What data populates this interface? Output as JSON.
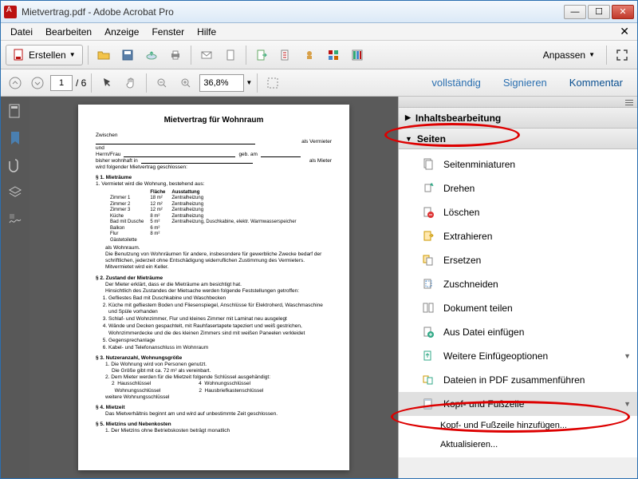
{
  "window": {
    "title": "Mietvertrag.pdf - Adobe Acrobat Pro"
  },
  "menu": {
    "file": "Datei",
    "edit": "Bearbeiten",
    "view": "Anzeige",
    "window": "Fenster",
    "help": "Hilfe"
  },
  "toolbar": {
    "create": "Erstellen",
    "customize": "Anpassen"
  },
  "pagebar": {
    "page": "1",
    "of": "/ 6",
    "zoom": "36,8%",
    "full": "vollständig",
    "sign": "Signieren",
    "comment": "Kommentar"
  },
  "rightpanel": {
    "content_edit": "Inhaltsbearbeitung",
    "pages": "Seiten",
    "items": {
      "thumbnails": "Seitenminiaturen",
      "rotate": "Drehen",
      "delete": "Löschen",
      "extract": "Extrahieren",
      "replace": "Ersetzen",
      "crop": "Zuschneiden",
      "split": "Dokument teilen",
      "insert_file": "Aus Datei einfügen",
      "more_insert": "Weitere Einfügeoptionen",
      "combine": "Dateien in PDF zusammenführen",
      "header_footer": "Kopf- und Fußzeile",
      "hf_add": "Kopf- und Fußzeile hinzufügen...",
      "hf_update": "Aktualisieren..."
    }
  },
  "doc": {
    "title": "Mietvertrag für Wohnraum",
    "between": "Zwischen",
    "as_landlord": "als Vermieter",
    "and": "und",
    "mrms": "Herrn/Frau",
    "born": "geb. am",
    "resident": "bisher wohnhaft in",
    "as_tenant": "als Mieter",
    "concluded": "wird folgender Mietvertrag geschlossen:",
    "s1": "§ 1.  Mieträume",
    "s1_1": "1.  Vermietet wird die Wohnung, bestehend aus:",
    "table_head": {
      "area": "Fläche",
      "equip": "Ausstattung"
    },
    "rooms": [
      {
        "n": "Zimmer 1",
        "a": "18 m²",
        "e": "Zentralheizung"
      },
      {
        "n": "Zimmer 2",
        "a": "12 m²",
        "e": "Zentralheizung"
      },
      {
        "n": "Zimmer 3",
        "a": "12 m²",
        "e": "Zentralheizung"
      },
      {
        "n": "Küche",
        "a": "8 m²",
        "e": "Zentralheizung"
      },
      {
        "n": "Bad mit Dusche",
        "a": "5 m²",
        "e": "Zentralheizung, Duschkabine, elektr. Warmwasserspeicher"
      },
      {
        "n": "Balkon",
        "a": "6 m²",
        "e": ""
      },
      {
        "n": "Flur",
        "a": "8 m²",
        "e": ""
      },
      {
        "n": "Gästetoilette",
        "a": "",
        "e": ""
      }
    ],
    "no_common": "als Wohnraum.",
    "s1_note": "Die Benutzung von Wohnräumen für andere, insbesondere für gewerbliche Zwecke bedarf der schriftlichen, jederzeit ohne Entschädigung widerruflichen Zustimmung des Vermieters. Mitvermietet wird ein Keller.",
    "s2": "§ 2.  Zustand der Mieträume",
    "s2_intro1": "Der Mieter erklärt, dass er die Mieträume am                      besichtigt hat.",
    "s2_intro2": "Hinsichtlich des Zustandes der Mietsache werden folgende Feststellungen getroffen:",
    "s2_items": [
      "Gefliestes Bad mit Duschkabine und Waschbecken",
      "Küche mit gefliestem Boden und Fliesenspiegel, Anschlüsse für Elektroherd, Waschmaschine und Spüle vorhanden",
      "Schlaf- und Wohnzimmer, Flur und kleines Zimmer mit Laminat neu ausgelegt",
      "Wände und Decken gespachtelt, mit Rauhfasertapete tapeziert und weiß gestrichen, Wohnzimmerdecke und die des kleinen Zimmers sind mit weißen Paneelen verkleidet",
      "Gegensprechanlage",
      "Kabel- und Telefonanschluss im Wohnraum"
    ],
    "s3": "§ 3.  Nutzeranzahl, Wohnungsgröße",
    "s3_1a": "1.  Die Wohnung wird von          Personen genutzt.",
    "s3_1b": "Die Größe gibt mit ca. 72 m² als vereinbart.",
    "s3_2": "2.  Dem Mieter werden für die Mietzeit folgende Schlüssel ausgehändigt:",
    "keys": {
      "a1": "2",
      "a1l": "Hausschlüssel",
      "a2": "4",
      "a2l": "Wohnungsschlüssel",
      "b1": "",
      "b1l": "Wohnungsschlüssel",
      "b2": "2",
      "b2l": "Hausbriefkastenschlüssel"
    },
    "s4": "§ 4.  Mietzeit",
    "s4_text": "Das Mietverhältnis beginnt am                      und wird auf unbestimmte Zeit geschlossen.",
    "s5": "§ 5.  Mietzins und Nebenkosten",
    "s5_1": "1.  Der Mietzins ohne Betriebskosten beträgt monatlich"
  }
}
